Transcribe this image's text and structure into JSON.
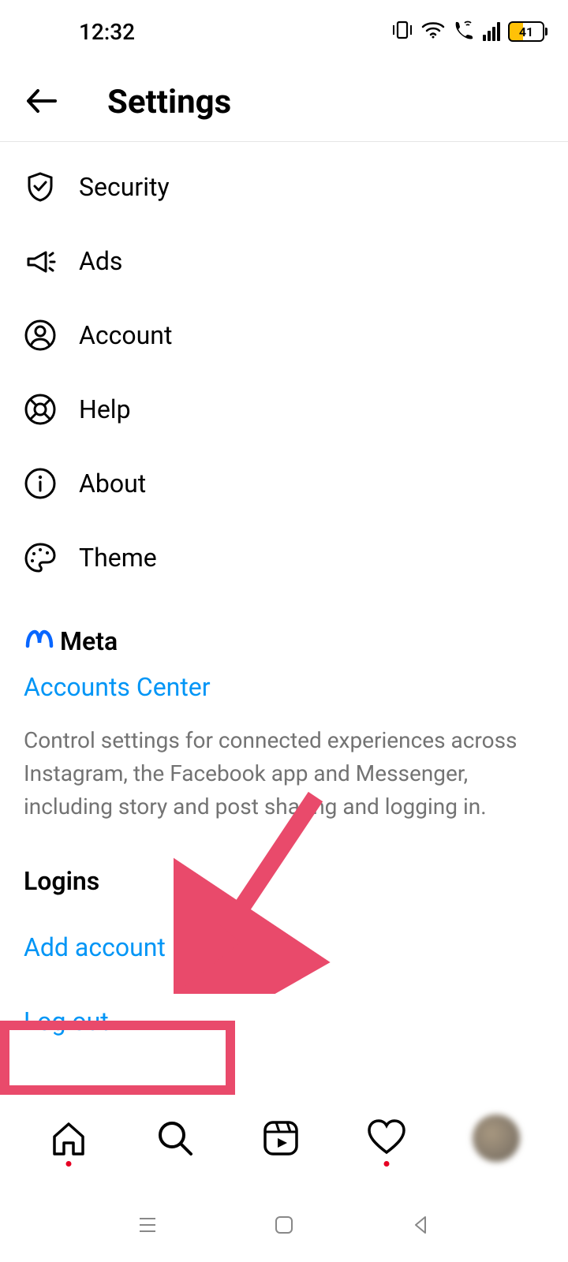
{
  "status": {
    "time": "12:32",
    "battery_pct": "41"
  },
  "header": {
    "title": "Settings"
  },
  "settings": {
    "items": [
      {
        "label": "Security"
      },
      {
        "label": "Ads"
      },
      {
        "label": "Account"
      },
      {
        "label": "Help"
      },
      {
        "label": "About"
      },
      {
        "label": "Theme"
      }
    ]
  },
  "meta": {
    "brand": "Meta",
    "accounts_center": "Accounts Center",
    "description": "Control settings for connected experiences across Instagram, the Facebook app and Messenger, including story and post sharing and logging in."
  },
  "logins": {
    "header": "Logins",
    "add_account": "Add account",
    "log_out": "Log out"
  },
  "colors": {
    "link": "#0095f6",
    "meta_blue": "#0866ff",
    "annotation": "#e94a6b",
    "text_secondary": "#737373"
  }
}
